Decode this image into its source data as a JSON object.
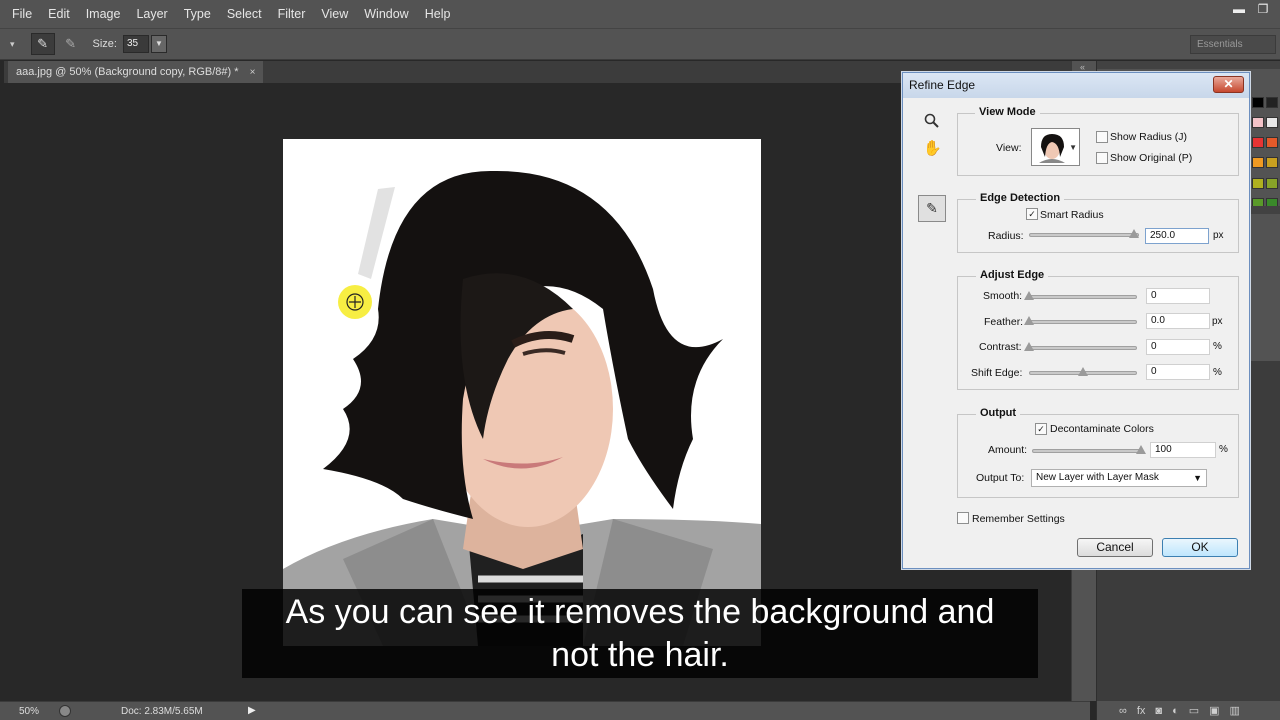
{
  "menu": [
    "File",
    "Edit",
    "Image",
    "Layer",
    "Type",
    "Select",
    "Filter",
    "View",
    "Window",
    "Help"
  ],
  "window_controls": {
    "minimize": "▬",
    "restore": "❐"
  },
  "options": {
    "size_label": "Size:",
    "size_value": "35",
    "workspace": "Essentials"
  },
  "document": {
    "tab_title": "aaa.jpg @ 50% (Background copy, RGB/8#) *",
    "close": "×"
  },
  "status": {
    "zoom": "50%",
    "doc": "Doc: 2.83M/5.65M",
    "arrow": "▶"
  },
  "dialog": {
    "title": "Refine Edge",
    "close": "✕",
    "view_mode": {
      "title": "View Mode",
      "view_label": "View:",
      "show_radius": "Show Radius (J)",
      "show_original": "Show Original (P)"
    },
    "edge_detection": {
      "title": "Edge Detection",
      "smart_radius": "Smart Radius",
      "radius_label": "Radius:",
      "radius_value": "250.0",
      "radius_unit": "px",
      "radius_fraction": 1.0
    },
    "adjust_edge": {
      "title": "Adjust Edge",
      "smooth_label": "Smooth:",
      "smooth_value": "0",
      "smooth_fraction": 0,
      "feather_label": "Feather:",
      "feather_value": "0.0",
      "feather_unit": "px",
      "feather_fraction": 0,
      "contrast_label": "Contrast:",
      "contrast_value": "0",
      "contrast_unit": "%",
      "contrast_fraction": 0,
      "shift_label": "Shift Edge:",
      "shift_value": "0",
      "shift_unit": "%",
      "shift_fraction": 0.5
    },
    "output": {
      "title": "Output",
      "decontaminate": "Decontaminate Colors",
      "amount_label": "Amount:",
      "amount_value": "100",
      "amount_unit": "%",
      "amount_fraction": 1.0,
      "output_to_label": "Output To:",
      "output_to_value": "New Layer with Layer Mask"
    },
    "remember": "Remember Settings",
    "cancel": "Cancel",
    "ok": "OK"
  },
  "subtitle": {
    "line1": "As you can see it removes the background and",
    "line2": "not the hair."
  },
  "colors": {
    "accent": "#3c7fb1",
    "dialog_bg": "#f0f0f0",
    "ui_gray": "#535353",
    "cursor_yellow": "#f5ea14"
  }
}
